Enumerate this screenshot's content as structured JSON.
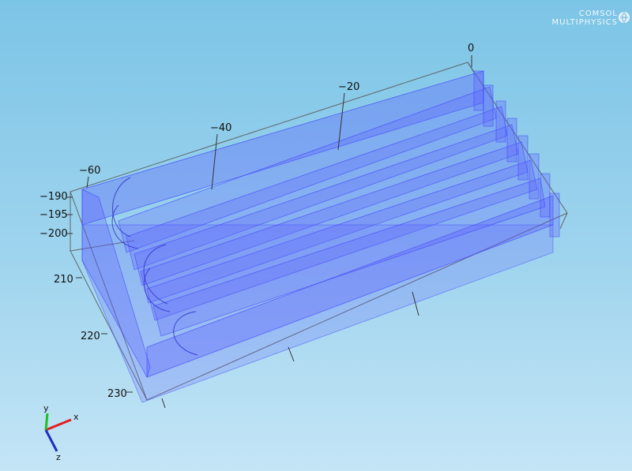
{
  "app": {
    "logo_line1": "COMSOL",
    "logo_line2": "MULTIPHYSICS"
  },
  "axis_ticks": {
    "top": [
      "0",
      "−20",
      "−40",
      "−60"
    ],
    "left_upper": [
      "−190",
      "−195",
      "−200"
    ],
    "left_lower": [
      "210",
      "220",
      "230"
    ]
  },
  "triad": {
    "x": "x",
    "y": "y",
    "z": "z"
  },
  "colors": {
    "background_top": "#7cc4e6",
    "background_bottom": "#c4e5f6",
    "plate_fill": "#5a5cff",
    "axis_x": "#e02020",
    "axis_y": "#20c020",
    "axis_z": "#2030c0"
  },
  "icons": {
    "logo_globe": "globe-icon"
  }
}
